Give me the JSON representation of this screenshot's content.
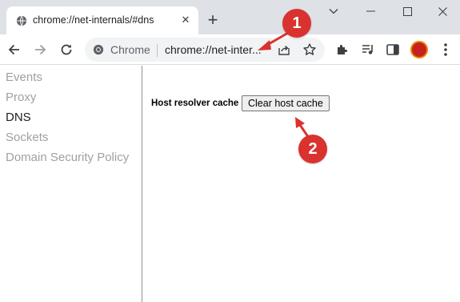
{
  "tab": {
    "title": "chrome://net-internals/#dns",
    "close_glyph": "✕",
    "favicon": "globe-icon"
  },
  "new_tab_glyph": "+",
  "omnibox": {
    "chip": "Chrome",
    "url": "chrome://net-inter..."
  },
  "sidebar": {
    "items": [
      {
        "label": "Events",
        "active": false
      },
      {
        "label": "Proxy",
        "active": false
      },
      {
        "label": "DNS",
        "active": true
      },
      {
        "label": "Sockets",
        "active": false
      },
      {
        "label": "Domain Security Policy",
        "active": false
      }
    ]
  },
  "main": {
    "host_resolver_label": "Host resolver cache",
    "clear_button_label": "Clear host cache"
  },
  "annotations": {
    "step1": "1",
    "step2": "2",
    "color": "#d9322f"
  },
  "colors": {
    "tabstrip": "#dee1e6",
    "omnibox": "#f1f3f4",
    "sidebar_inactive": "#a0a0a0",
    "sidebar_active": "#202020"
  }
}
